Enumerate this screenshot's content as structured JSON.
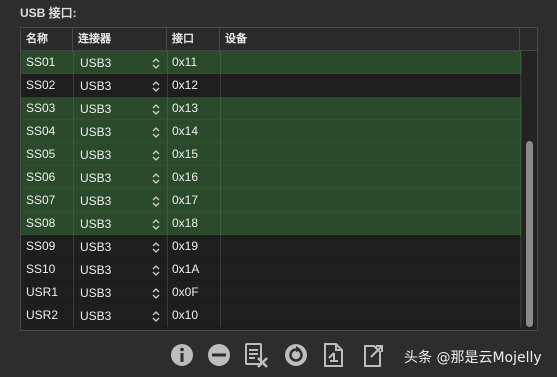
{
  "section": {
    "title": "USB 接口:"
  },
  "table": {
    "columns": [
      "名称",
      "连接器",
      "接口",
      "设备"
    ],
    "rows": [
      {
        "name": "SS01",
        "connector": "USB3",
        "port": "0x11",
        "device": "",
        "selected": true
      },
      {
        "name": "SS02",
        "connector": "USB3",
        "port": "0x12",
        "device": "",
        "selected": false
      },
      {
        "name": "SS03",
        "connector": "USB3",
        "port": "0x13",
        "device": "",
        "selected": true
      },
      {
        "name": "SS04",
        "connector": "USB3",
        "port": "0x14",
        "device": "",
        "selected": true
      },
      {
        "name": "SS05",
        "connector": "USB3",
        "port": "0x15",
        "device": "",
        "selected": true
      },
      {
        "name": "SS06",
        "connector": "USB3",
        "port": "0x16",
        "device": "",
        "selected": true
      },
      {
        "name": "SS07",
        "connector": "USB3",
        "port": "0x17",
        "device": "",
        "selected": true
      },
      {
        "name": "SS08",
        "connector": "USB3",
        "port": "0x18",
        "device": "",
        "selected": true
      },
      {
        "name": "SS09",
        "connector": "USB3",
        "port": "0x19",
        "device": "",
        "selected": false
      },
      {
        "name": "SS10",
        "connector": "USB3",
        "port": "0x1A",
        "device": "",
        "selected": false
      },
      {
        "name": "USR1",
        "connector": "USB3",
        "port": "0x0F",
        "device": "",
        "selected": false
      },
      {
        "name": "USR2",
        "connector": "USB3",
        "port": "0x10",
        "device": "",
        "selected": false
      }
    ]
  },
  "toolbar": {
    "icons": [
      "info-icon",
      "remove-icon",
      "clear-list-icon",
      "refresh-icon",
      "import-icon",
      "export-icon"
    ]
  },
  "watermark": {
    "text": "头条 @那是云Mojelly"
  },
  "colors": {
    "selected_row": "#2b4a2b",
    "background": "#2d2d2e",
    "table_bg": "#1e1e1f"
  }
}
